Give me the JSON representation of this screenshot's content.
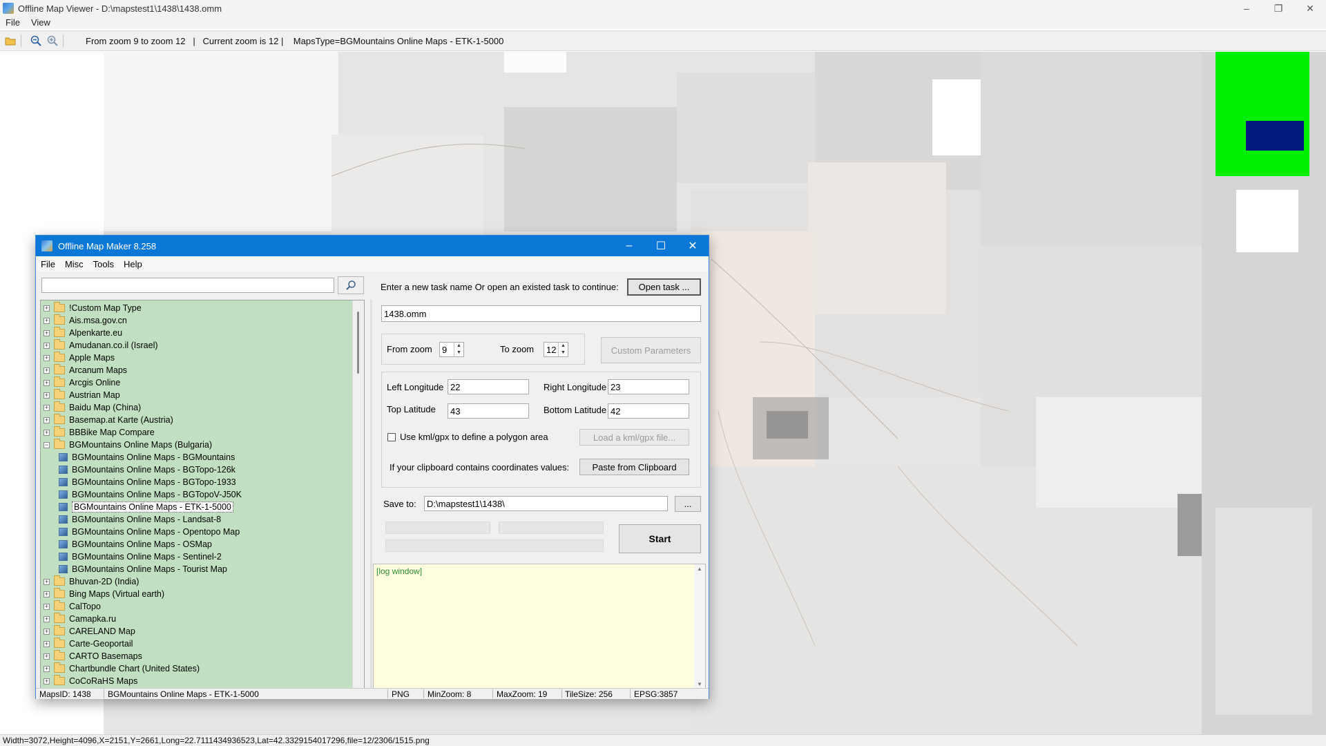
{
  "viewer": {
    "title": "Offline Map Viewer - D:\\mapstest1\\1438\\1438.omm",
    "menu": [
      "File",
      "View"
    ],
    "toolbar_status": "From zoom 9 to zoom 12   |   Current zoom is 12 |    MapsType=BGMountains Online Maps - ETK-1-5000",
    "statusbar": "Width=3072,Height=4096,X=2151,Y=2661,Long=22.7111434936523,Lat=42.3329154017296,file=12/2306/1515.png",
    "icons": [
      "open-folder-icon",
      "zoom-out-icon",
      "zoom-in-icon"
    ],
    "overview_colors": {
      "background": "#00ee00",
      "viewport": "#001a80"
    }
  },
  "omm": {
    "title": "Offline Map Maker 8.258",
    "menu": [
      "File",
      "Misc",
      "Tools",
      "Help"
    ],
    "search_value": "",
    "tree": [
      {
        "label": "!Custom Map Type",
        "type": "folder"
      },
      {
        "label": "Ais.msa.gov.cn",
        "type": "folder"
      },
      {
        "label": "Alpenkarte.eu",
        "type": "folder"
      },
      {
        "label": "Amudanan.co.il (Israel)",
        "type": "folder"
      },
      {
        "label": "Apple Maps",
        "type": "folder"
      },
      {
        "label": "Arcanum Maps",
        "type": "folder"
      },
      {
        "label": "Arcgis Online",
        "type": "folder"
      },
      {
        "label": "Austrian Map",
        "type": "folder"
      },
      {
        "label": "Baidu Map (China)",
        "type": "folder"
      },
      {
        "label": "Basemap.at Karte (Austria)",
        "type": "folder"
      },
      {
        "label": "BBBike Map Compare",
        "type": "folder"
      },
      {
        "label": "BGMountains Online Maps (Bulgaria)",
        "type": "folder-open"
      },
      {
        "label": "BGMountains Online Maps - BGMountains",
        "type": "map"
      },
      {
        "label": "BGMountains Online Maps - BGTopo-126k",
        "type": "map"
      },
      {
        "label": "BGMountains Online Maps - BGTopo-1933",
        "type": "map"
      },
      {
        "label": "BGMountains Online Maps - BGTopoV-J50K",
        "type": "map"
      },
      {
        "label": "BGMountains Online Maps - ETK-1-5000",
        "type": "map",
        "selected": true
      },
      {
        "label": "BGMountains Online Maps - Landsat-8",
        "type": "map"
      },
      {
        "label": "BGMountains Online Maps - Opentopo Map",
        "type": "map"
      },
      {
        "label": "BGMountains Online Maps - OSMap",
        "type": "map"
      },
      {
        "label": "BGMountains Online Maps - Sentinel-2",
        "type": "map"
      },
      {
        "label": "BGMountains Online Maps - Tourist Map",
        "type": "map"
      },
      {
        "label": "Bhuvan-2D (India)",
        "type": "folder"
      },
      {
        "label": "Bing Maps (Virtual earth)",
        "type": "folder"
      },
      {
        "label": "CalTopo",
        "type": "folder"
      },
      {
        "label": "Camapka.ru",
        "type": "folder"
      },
      {
        "label": "CARELAND Map",
        "type": "folder"
      },
      {
        "label": "Carte-Geoportail",
        "type": "folder"
      },
      {
        "label": "CARTO Basemaps",
        "type": "folder"
      },
      {
        "label": "Chartbundle Chart (United States)",
        "type": "folder"
      },
      {
        "label": "CoCoRaHS Maps",
        "type": "folder"
      }
    ],
    "task": {
      "prompt": "Enter a new task name Or open an existed task to continue:",
      "open_button": "Open task ...",
      "name_value": "1438.omm"
    },
    "zoom": {
      "from_label": "From zoom",
      "from_value": "9",
      "to_label": "To zoom",
      "to_value": "12",
      "custom_button": "Custom Parameters"
    },
    "coords": {
      "left_lon_label": "Left Longitude",
      "left_lon_value": "22",
      "right_lon_label": "Right Longitude",
      "right_lon_value": "23",
      "top_lat_label": "Top Latitude",
      "top_lat_value": "43",
      "bottom_lat_label": "Bottom Latitude",
      "bottom_lat_value": "42",
      "kml_checkbox_label": "Use kml/gpx to define a polygon area",
      "load_kml_button": "Load a kml/gpx file...",
      "clipboard_label": "If your clipboard contains coordinates values:",
      "paste_button": "Paste from Clipboard"
    },
    "save": {
      "label": "Save to:",
      "path_value": "D:\\mapstest1\\1438\\",
      "browse_button": "...",
      "start_button": "Start"
    },
    "log_text": "[log window]",
    "status": {
      "maps_id": "MapsID: 1438",
      "map_name": "BGMountains Online Maps - ETK-1-5000",
      "format": "PNG",
      "min_zoom": "MinZoom: 8",
      "max_zoom": "MaxZoom: 19",
      "tile_size": "TileSize: 256",
      "epsg": "EPSG:3857"
    }
  }
}
